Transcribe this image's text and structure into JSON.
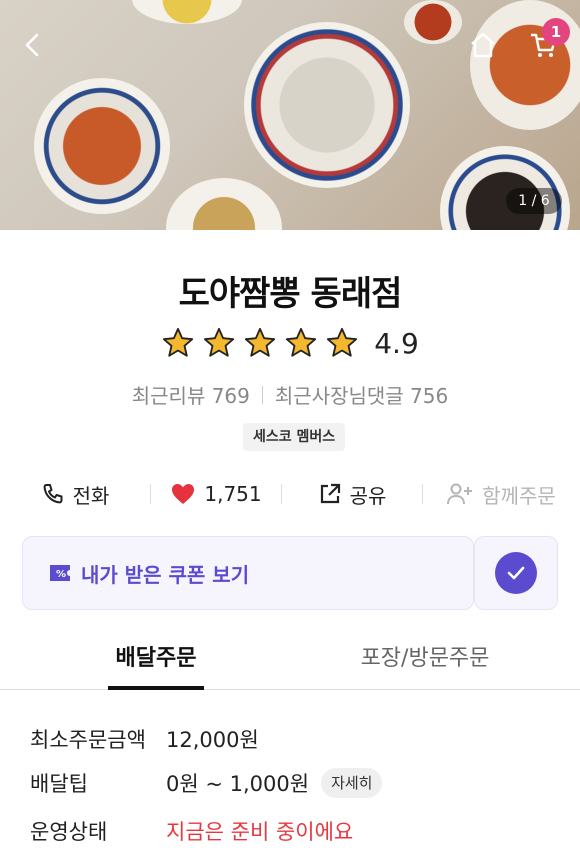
{
  "hero": {
    "image_counter": "1 / 6",
    "cart_count": "1"
  },
  "store": {
    "name": "도야짬뽕 동래점",
    "rating": "4.9",
    "stars": 5,
    "recent_reviews": "최근리뷰 769",
    "owner_replies": "최근사장님댓글 756",
    "membership_badge": "세스코 멤버스"
  },
  "actions": {
    "call": "전화",
    "likes": "1,751",
    "share": "공유",
    "group_order": "함께주문"
  },
  "coupon": {
    "label": "내가 받은 쿠폰 보기"
  },
  "tabs": {
    "delivery": "배달주문",
    "pickup": "포장/방문주문"
  },
  "info": {
    "min_order_label": "최소주문금액",
    "min_order_value": "12,000원",
    "delivery_tip_label": "배달팁",
    "delivery_tip_value": "0원 ~ 1,000원",
    "detail_label": "자세히",
    "status_label": "운영상태",
    "status_value": "지금은 준비 중이에요"
  },
  "colors": {
    "accent": "#5b4ccf",
    "heart": "#e5323c",
    "status": "#e8383f",
    "badge": "#e3457f"
  }
}
